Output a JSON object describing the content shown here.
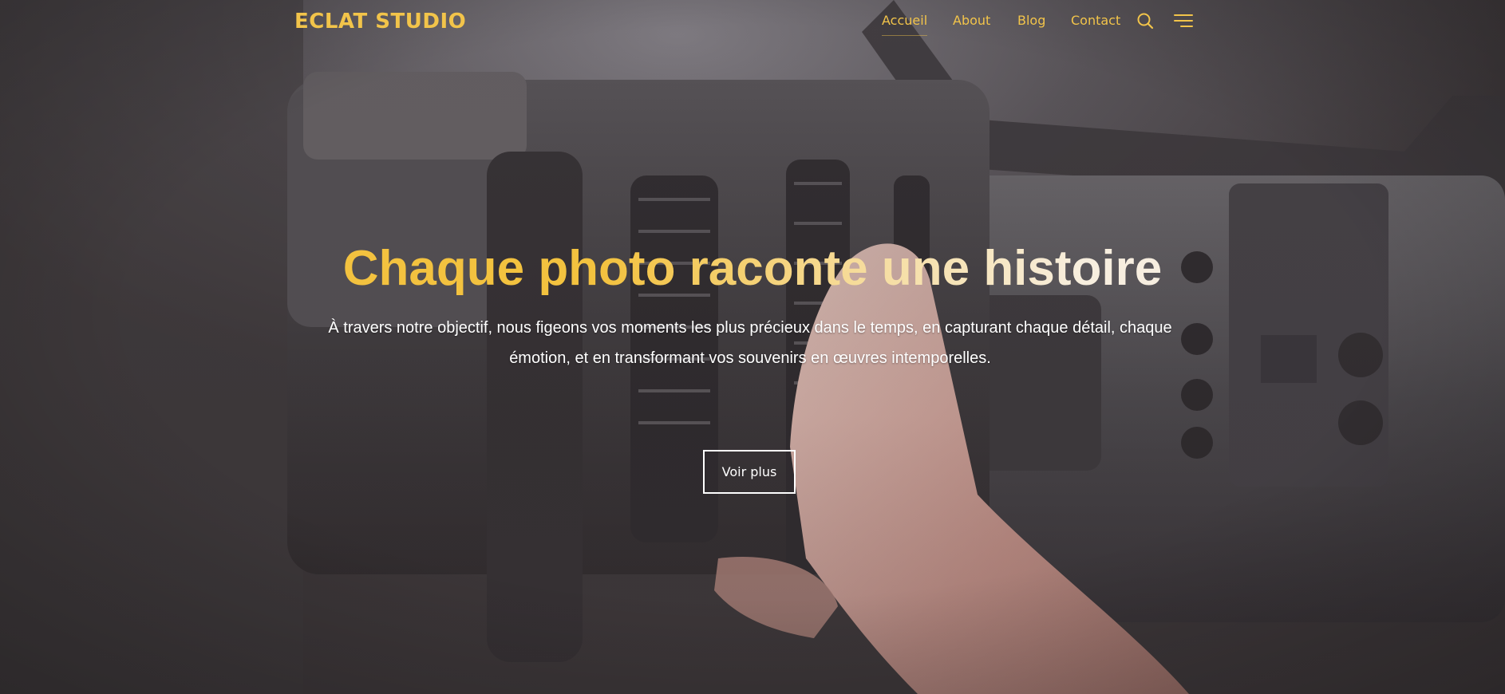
{
  "site": {
    "logo": "ECLAT STUDIO"
  },
  "nav": {
    "items": [
      {
        "label": "Accueil",
        "active": true
      },
      {
        "label": "About",
        "active": false
      },
      {
        "label": "Blog",
        "active": false
      },
      {
        "label": "Contact",
        "active": false
      }
    ],
    "search_icon": "search-icon",
    "menu_icon": "menu-lines-icon"
  },
  "hero": {
    "headline": "Chaque photo raconte une histoire",
    "subtitle_line1": "À travers notre objectif, nous figeons vos moments les plus précieux dans le temps, en capturant chaque détail, chaque",
    "subtitle_line2": "émotion, et en transformant vos souvenirs en œuvres intemporelles.",
    "cta_label": "Voir plus",
    "background": "camera-hand-photo"
  },
  "colors": {
    "accent": "#f2c44a",
    "text_light": "#ffffff"
  }
}
